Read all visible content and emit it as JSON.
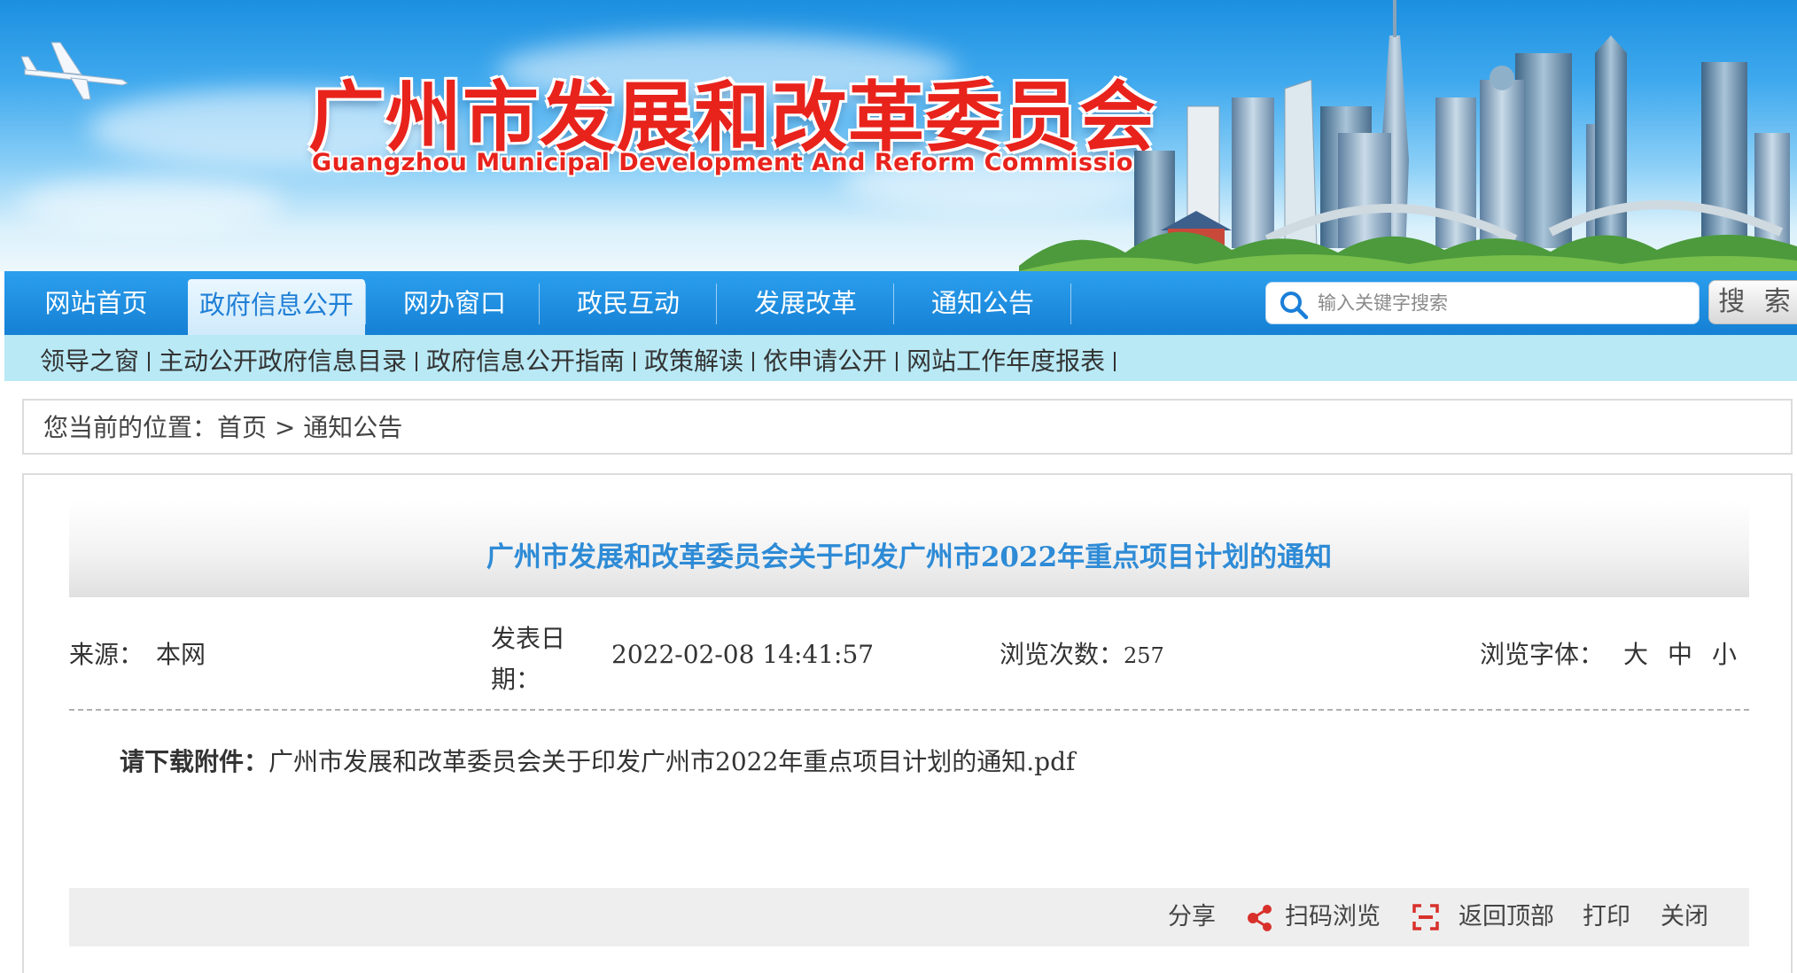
{
  "header": {
    "title": "广州市发展和改革委员会",
    "subtitle": "Guangzhou Municipal Development And Reform Commission"
  },
  "nav": {
    "items": [
      "网站首页",
      "政府信息公开",
      "网办窗口",
      "政民互动",
      "发展改革",
      "通知公告"
    ],
    "active_index": 1
  },
  "search": {
    "placeholder": "输入关键字搜索",
    "button_label": "搜 索"
  },
  "subnav": {
    "items": [
      "领导之窗",
      "主动公开政府信息目录",
      "政府信息公开指南",
      "政策解读",
      "依申请公开",
      "网站工作年度报表"
    ]
  },
  "breadcrumb": {
    "prefix": "您当前的位置：",
    "home": "首页",
    "separator": " > ",
    "current": "通知公告"
  },
  "article": {
    "title": "广州市发展和改革委员会关于印发广州市2022年重点项目计划的通知",
    "source_label": "来源：",
    "source_value": "本网",
    "date_label_line1": "发表日",
    "date_label_line2": "期：",
    "date_value": "2022-02-08 14:41:57",
    "views_label": "浏览次数：",
    "views_value": "257",
    "font_label": "浏览字体：",
    "font_sizes": [
      "大",
      "中",
      "小"
    ],
    "attachment_label": "请下载附件：",
    "attachment_file": "广州市发展和改革委员会关于印发广州市2022年重点项目计划的通知.pdf"
  },
  "toolbar": {
    "share": "分享",
    "scan": "扫码浏览",
    "back_top": "返回顶部",
    "print": "打印",
    "close": "关闭"
  },
  "icons": {
    "search": "search-icon",
    "share": "share-icon",
    "qr": "qr-code-icon"
  },
  "colors": {
    "nav": "#1a86dc",
    "title_red": "#e8231c",
    "article_title": "#2e8bd6",
    "subnav": "#b8e9f5",
    "share_icon": "#d8312c"
  }
}
